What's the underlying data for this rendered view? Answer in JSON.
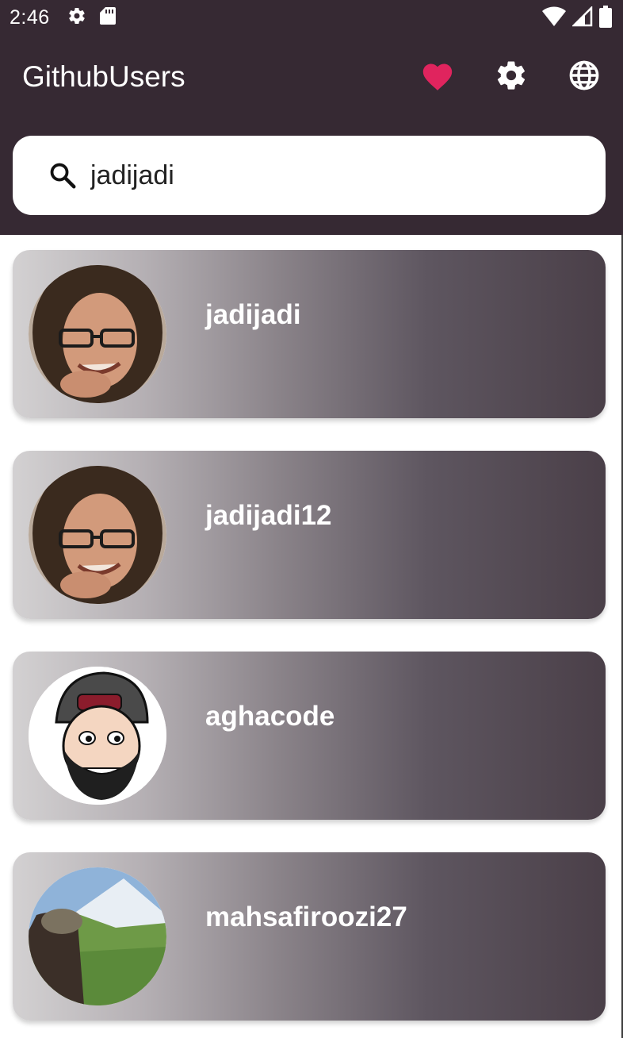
{
  "status_bar": {
    "time": "2:46",
    "icons_left": [
      "gear-icon",
      "sd-card-icon"
    ],
    "icons_right": [
      "wifi-icon",
      "signal-icon",
      "battery-icon"
    ]
  },
  "app_bar": {
    "title": "GithubUsers",
    "background": "#362933",
    "actions": [
      {
        "name": "favorites",
        "icon": "heart-icon",
        "color": "#e0245e"
      },
      {
        "name": "settings",
        "icon": "gear-icon",
        "color": "#ffffff"
      },
      {
        "name": "language",
        "icon": "globe-icon",
        "color": "#ffffff"
      }
    ]
  },
  "search": {
    "icon": "search-icon",
    "value": "jadijadi"
  },
  "users": [
    {
      "username": "jadijadi",
      "avatar": "photo-man-glasses"
    },
    {
      "username": "jadijadi12",
      "avatar": "photo-man-glasses"
    },
    {
      "username": "aghacode",
      "avatar": "cartoon-cap-beard"
    },
    {
      "username": "mahsafiroozi27",
      "avatar": "photo-mountain-landscape"
    }
  ]
}
